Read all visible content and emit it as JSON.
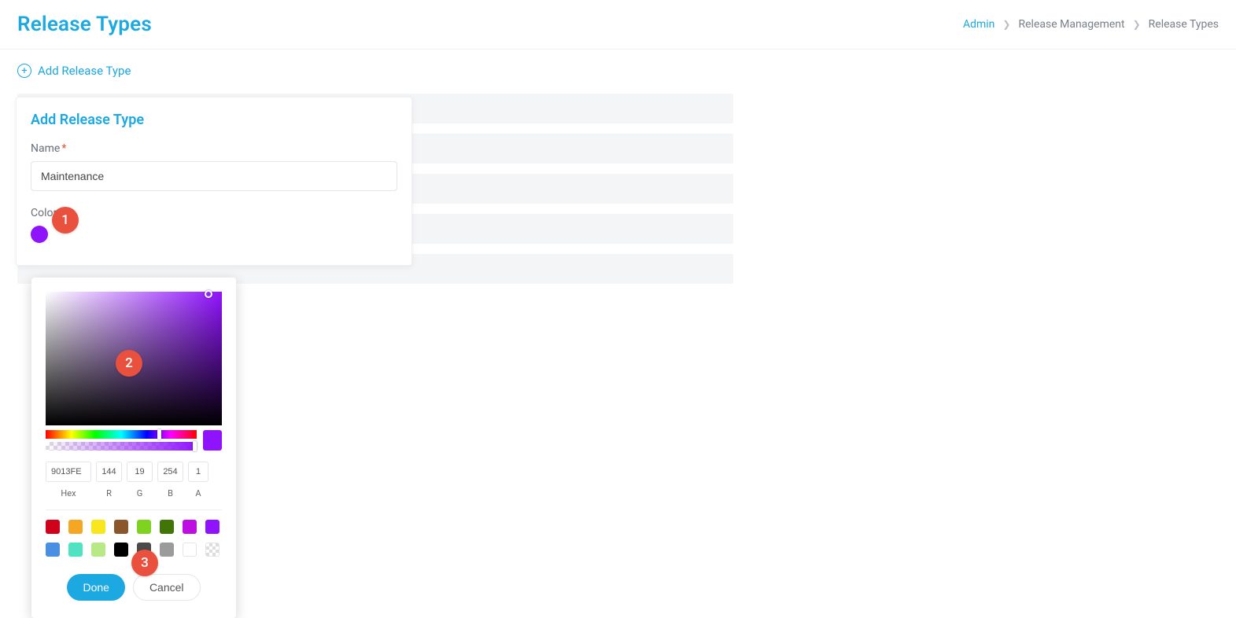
{
  "header": {
    "title": "Release Types",
    "breadcrumb": [
      "Admin",
      "Release Management",
      "Release Types"
    ]
  },
  "add_link": {
    "label": "Add Release Type"
  },
  "form": {
    "title": "Add Release Type",
    "name_label": "Name",
    "name_value": "Maintenance",
    "color_label": "Color",
    "color_value": "#9013FE"
  },
  "picker": {
    "hex": "9013FE",
    "r": "144",
    "g": "19",
    "b": "254",
    "a": "1",
    "labels": {
      "hex": "Hex",
      "r": "R",
      "g": "G",
      "b": "B",
      "a": "A"
    },
    "swatches": [
      "#d0021b",
      "#f5a623",
      "#f8e71c",
      "#8b572a",
      "#7ed321",
      "#417505",
      "#bd10e0",
      "#9013fe",
      "#4a90e2",
      "#50e3c2",
      "#b8e986",
      "#000000",
      "#4a4a4a",
      "#9b9b9b",
      "#ffffff",
      "transparent"
    ],
    "done": "Done",
    "cancel": "Cancel"
  },
  "annotations": {
    "a1": "1",
    "a2": "2",
    "a3": "3"
  }
}
